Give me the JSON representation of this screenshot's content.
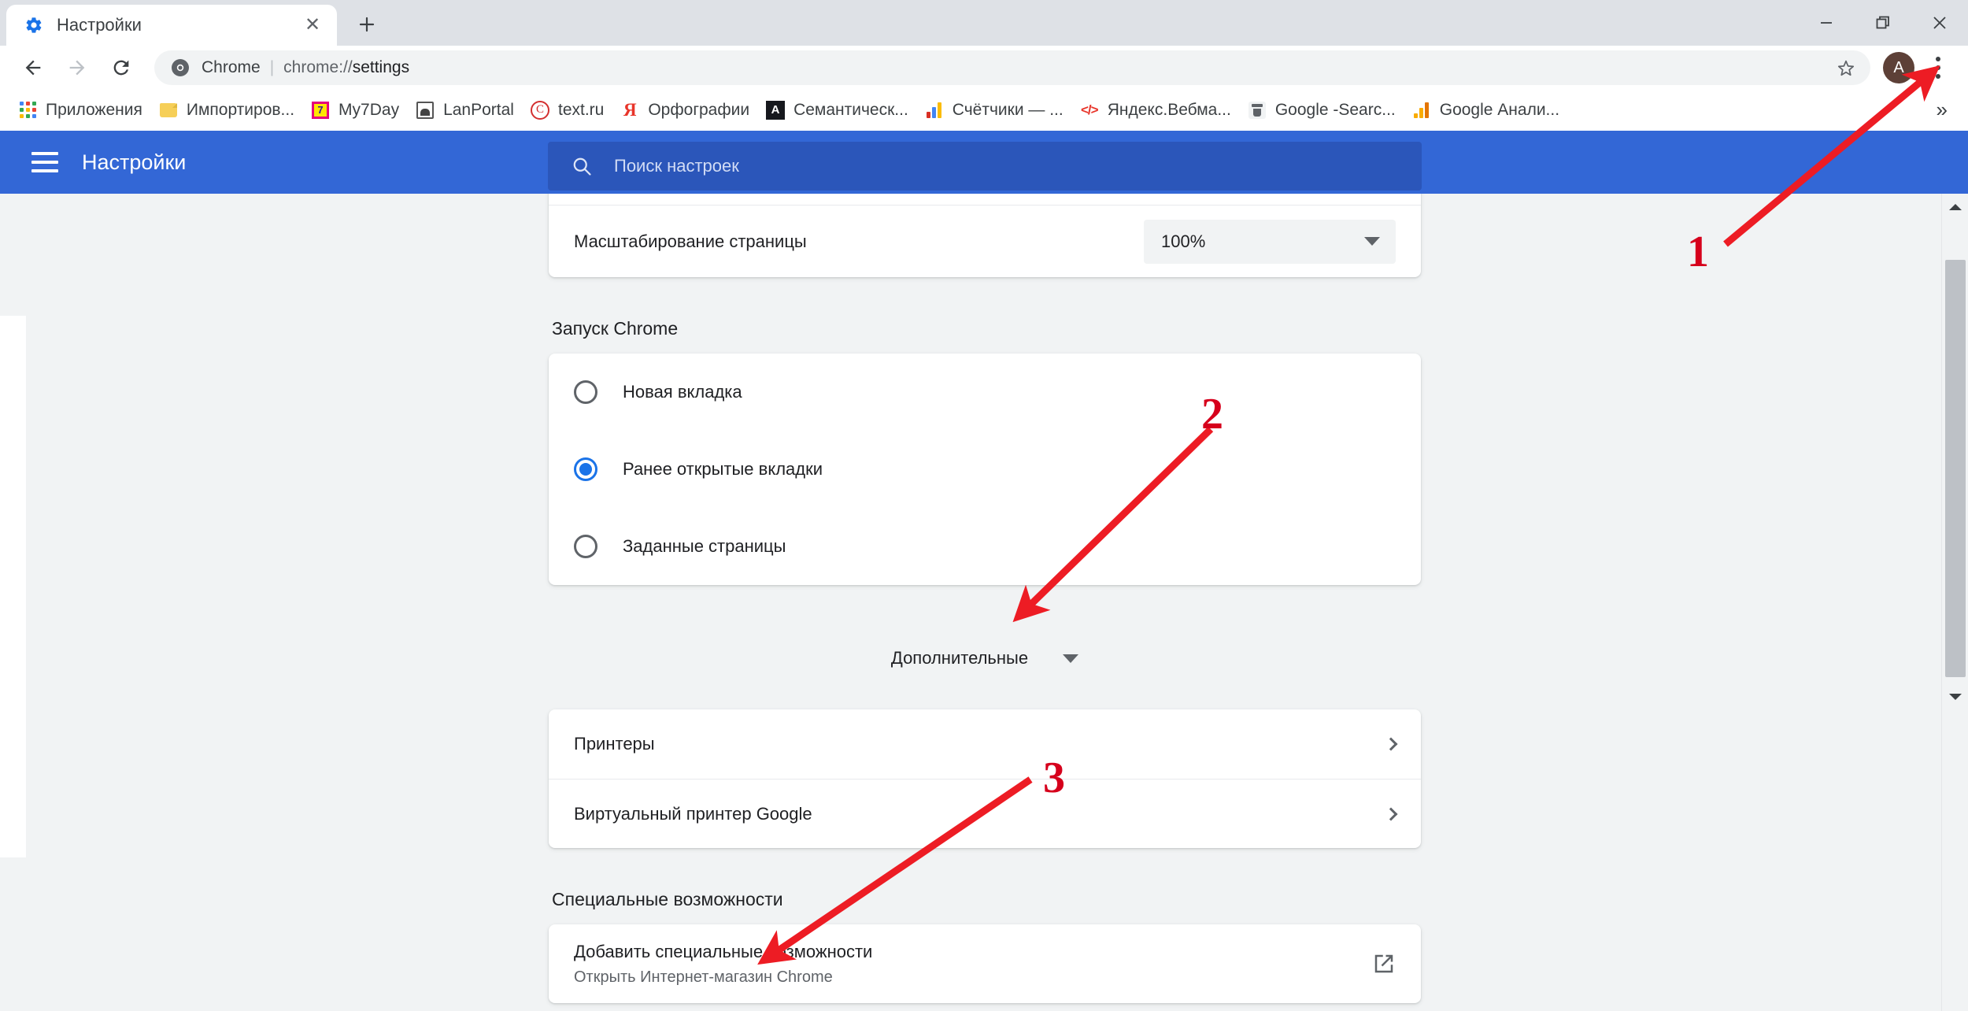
{
  "window": {
    "controls": {
      "minimize": "−",
      "maximize": "❐",
      "close": "✕"
    }
  },
  "tabs": [
    {
      "title": "Настройки",
      "favicon": "gear-icon",
      "close_label": "✕"
    }
  ],
  "newtab_label": "+",
  "toolbar": {
    "back_label": "←",
    "forward_label": "→",
    "reload_label": "⟳",
    "omnibox": {
      "chip": "Chrome",
      "separator": "|",
      "url_prefix": "chrome://",
      "url_bold": "settings",
      "star_label": "☆"
    },
    "avatar_letter": "A",
    "avatar_color": "#5d4037",
    "menu_label": "⋮"
  },
  "bookmarks": {
    "items": [
      {
        "label": "Приложения",
        "icon": "apps-grid-icon"
      },
      {
        "label": "Импортиров...",
        "icon": "folder-icon"
      },
      {
        "label": "My7Day",
        "icon": "my7day-icon"
      },
      {
        "label": "LanPortal",
        "icon": "lanportal-icon"
      },
      {
        "label": "text.ru",
        "icon": "copyright-icon"
      },
      {
        "label": "Орфографии",
        "icon": "yandex-icon"
      },
      {
        "label": "Семантическ...",
        "icon": "semantica-icon"
      },
      {
        "label": "Счётчики — ...",
        "icon": "bar-chart-icon"
      },
      {
        "label": "Яндекс.Вебма...",
        "icon": "code-brackets-icon"
      },
      {
        "label": "Google -Searc...",
        "icon": "google-search-console-icon"
      },
      {
        "label": "Google Анали...",
        "icon": "google-analytics-icon"
      }
    ],
    "overflow_label": "»"
  },
  "settings_header": {
    "menu_label": "☰",
    "title": "Настройки",
    "search_placeholder": "Поиск настроек",
    "search_value": "",
    "background_color": "#3367d6"
  },
  "main": {
    "appearance": {
      "zoom_row_label": "Масштабирование страницы",
      "zoom_value": "100%"
    },
    "startup": {
      "section_title": "Запуск Chrome",
      "options": [
        {
          "label": "Новая вкладка",
          "selected": false
        },
        {
          "label": "Ранее открытые вкладки",
          "selected": true
        },
        {
          "label": "Заданные страницы",
          "selected": false
        }
      ]
    },
    "advanced": {
      "label": "Дополнительные",
      "expanded": false
    },
    "printing": {
      "rows": [
        {
          "label": "Принтеры"
        },
        {
          "label": "Виртуальный принтер Google"
        }
      ]
    },
    "accessibility": {
      "section_title": "Специальные возможности",
      "row": {
        "title": "Добавить специальные возможности",
        "subtitle": "Открыть Интернет-магазин Chrome"
      }
    }
  },
  "annotations": {
    "color": "#d6001c",
    "markers": [
      {
        "number": "1",
        "target": "chrome-menu-button"
      },
      {
        "number": "2",
        "target": "advanced-expand-button"
      },
      {
        "number": "3",
        "target": "add-accessibility-features-row"
      }
    ]
  },
  "scrollbar": {
    "up_label": "▲",
    "down_label": "▼"
  }
}
